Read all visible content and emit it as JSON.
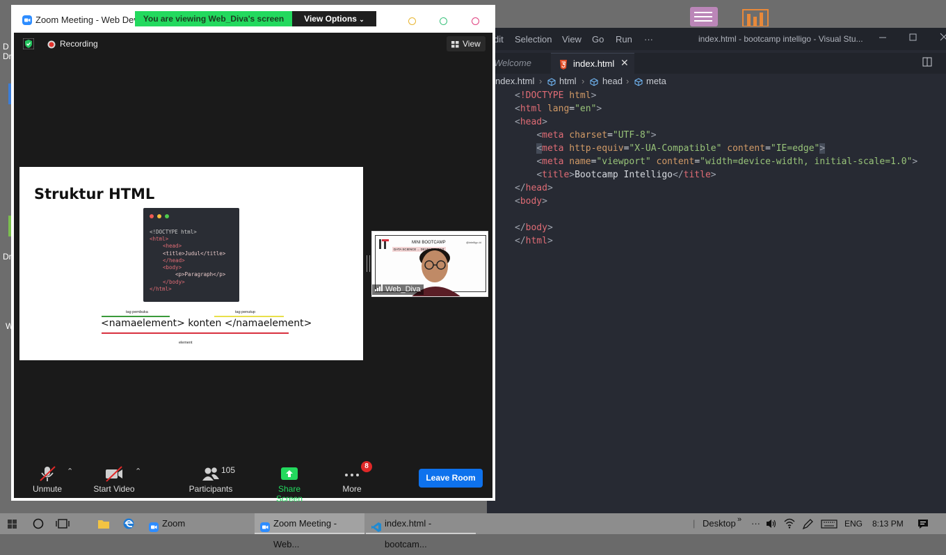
{
  "zoom": {
    "window_title": "Zoom Meeting - Web Deve",
    "viewing_banner": "You are viewing Web_Diva's screen",
    "view_options": "View Options",
    "recording": "Recording",
    "view_button": "View",
    "participant_name": "Web_Diva",
    "toolbar": {
      "unmute": "Unmute",
      "start_video": "Start Video",
      "participants": "Participants",
      "participant_count": "105",
      "share_screen": "Share Screen",
      "more": "More",
      "more_badge": "8",
      "leave": "Leave Room"
    },
    "colors": {
      "share_green": "#23d95e",
      "leave_blue": "#0e72ed",
      "badge_red": "#e02828"
    }
  },
  "slide": {
    "title": "Struktur HTML",
    "code_lines": [
      "<!DOCTYPE html>",
      "<html>",
      "<head>",
      "<title>Judul</title>",
      "</head>",
      "<body>",
      "<p>Paragraph</p>",
      "</body>",
      "</html>"
    ],
    "label_open": "tag pembuka",
    "label_close": "tag penutup",
    "formula": "<namaelement> konten </namaelement>",
    "label_element": "element"
  },
  "thumbnail": {
    "banner_title": "MINI BOOTCAMP",
    "banner_subtitle": "DATA SCIENCE ... DEVELOPMENT",
    "handle": "@intelligo.id"
  },
  "vscode": {
    "menu": [
      "dit",
      "Selection",
      "View",
      "Go",
      "Run",
      "···"
    ],
    "title": "index.html - bootcamp intelligo - Visual Stu...",
    "tabs": [
      {
        "label": "Welcome"
      },
      {
        "label": "index.html"
      }
    ],
    "breadcrumb": [
      "ndex.html",
      "html",
      "head",
      "meta"
    ],
    "code": [
      "<!DOCTYPE html>",
      "<html lang=\"en\">",
      "<head>",
      "    <meta charset=\"UTF-8\">",
      "    <meta http-equiv=\"X-UA-Compatible\" content=\"IE=edge\">",
      "    <meta name=\"viewport\" content=\"width=device-width, initial-scale=1.0\">",
      "    <title>Bootcamp Intelligo</title>",
      "</head>",
      "<body>",
      "",
      "</body>",
      "</html>"
    ]
  },
  "desktop": {
    "icon_labels": [
      "D",
      "Dr",
      "Dr",
      "W"
    ]
  },
  "taskbar": {
    "apps": [
      {
        "label": "Zoom"
      },
      {
        "label": "Zoom Meeting - Web..."
      },
      {
        "label": "index.html - bootcam..."
      }
    ],
    "desktop": "Desktop",
    "lang": "ENG",
    "time": "8:13 PM"
  }
}
